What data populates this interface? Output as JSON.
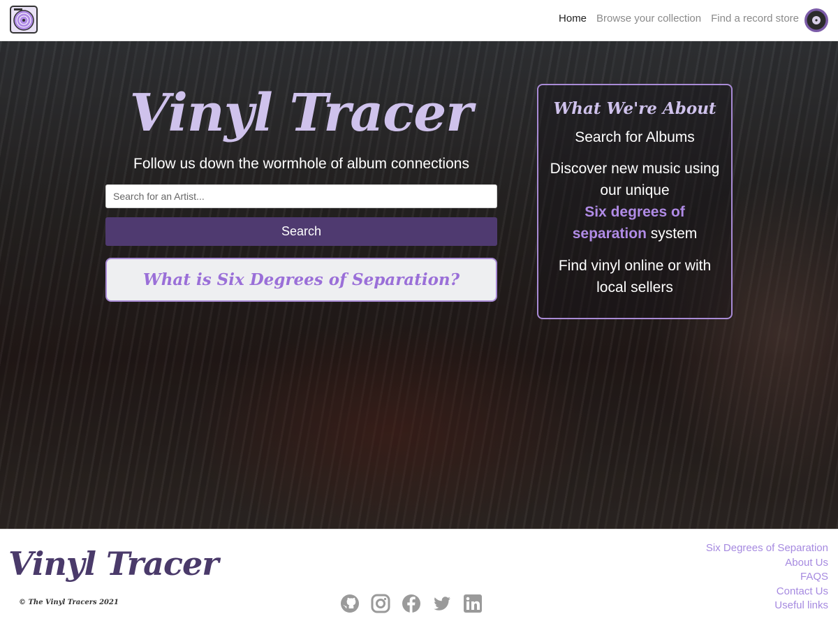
{
  "nav": {
    "links": [
      {
        "label": "Home",
        "active": true
      },
      {
        "label": "Browse your collection",
        "active": false
      },
      {
        "label": "Find a record store",
        "active": false
      }
    ]
  },
  "hero": {
    "title": "Vinyl Tracer",
    "tagline": "Follow us down the wormhole of album connections",
    "search_placeholder": "Search for an Artist...",
    "search_button": "Search",
    "six_degrees_button": "What is Six Degrees of Separation?"
  },
  "about": {
    "title": "What We're About",
    "line1": "Search for Albums",
    "line2_pre": "Discover new music using our unique",
    "line2_highlight1": "Six degrees of",
    "line2_highlight2": "separation",
    "line2_post": "system",
    "line3": "Find vinyl online or with local sellers"
  },
  "footer": {
    "brand": "Vinyl Tracer",
    "copyright": "© The Vinyl Tracers 2021",
    "links": [
      "Six Degrees of Separation",
      "About Us",
      "FAQS",
      "Contact Us",
      "Useful links"
    ],
    "social": [
      "github-icon",
      "instagram-icon",
      "facebook-icon",
      "twitter-icon",
      "linkedin-icon"
    ]
  },
  "colors": {
    "accent": "#a98bd6",
    "primary_button": "#4f3a70",
    "title_lavender": "#cfc2ec",
    "highlight_purple": "#b08be6"
  }
}
